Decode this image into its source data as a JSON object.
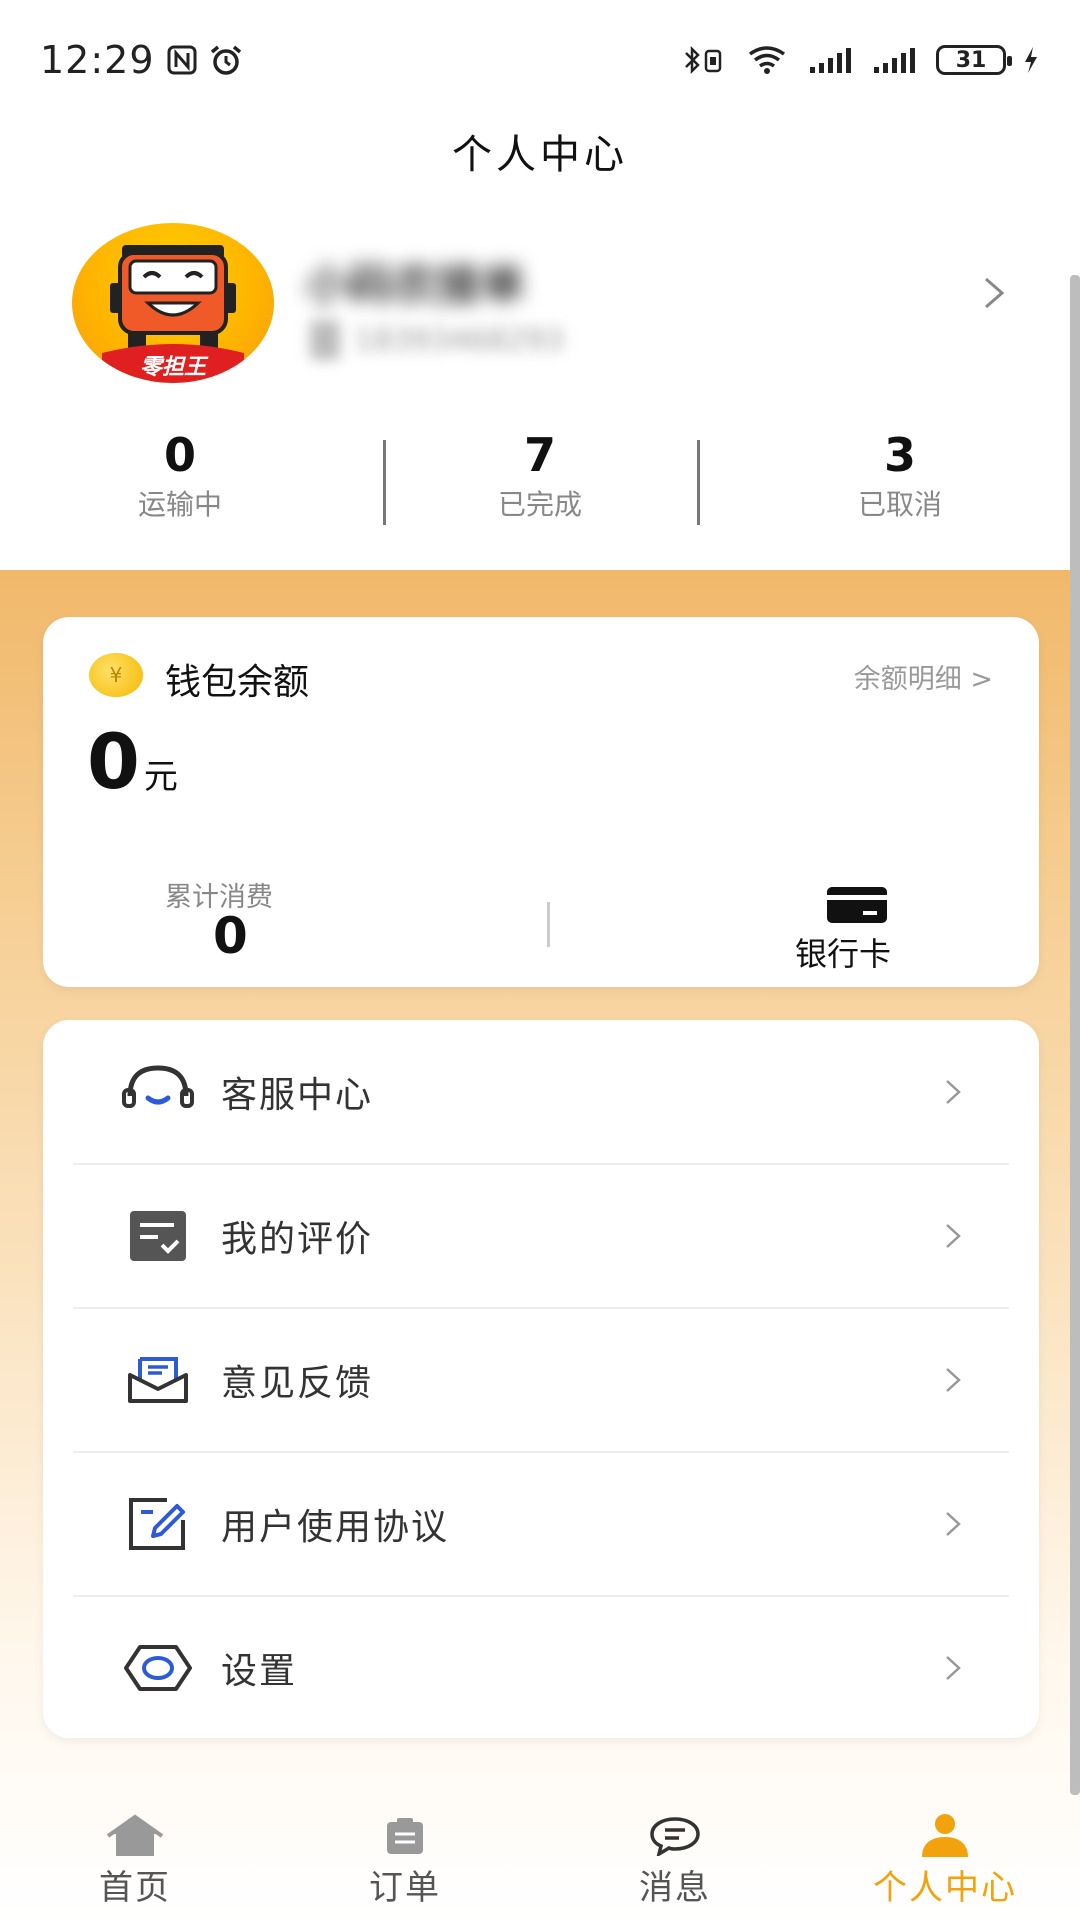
{
  "status_bar": {
    "time": "12:29",
    "battery": "31"
  },
  "header": {
    "title": "个人中心"
  },
  "profile": {
    "avatar_text": "零担王",
    "name": "小码农接单",
    "phone": "18393468293"
  },
  "stats": [
    {
      "value": "0",
      "label": "运输中"
    },
    {
      "value": "7",
      "label": "已完成"
    },
    {
      "value": "3",
      "label": "已取消"
    }
  ],
  "wallet": {
    "coin_symbol": "¥",
    "title": "钱包余额",
    "detail_link": "余额明细 >",
    "balance": "0",
    "unit": "元",
    "cumulative_label": "累计消费",
    "cumulative_value": "0",
    "bank_card_label": "银行卡"
  },
  "menu": [
    {
      "label": "客服中心",
      "icon": "headset-icon"
    },
    {
      "label": "我的评价",
      "icon": "review-icon"
    },
    {
      "label": "意见反馈",
      "icon": "feedback-mail-icon"
    },
    {
      "label": "用户使用协议",
      "icon": "agreement-edit-icon"
    },
    {
      "label": "设置",
      "icon": "settings-hexagon-icon"
    }
  ],
  "tabs": [
    {
      "label": "首页",
      "icon": "home-icon",
      "active": false
    },
    {
      "label": "订单",
      "icon": "clipboard-icon",
      "active": false
    },
    {
      "label": "消息",
      "icon": "chat-bubble-icon",
      "active": false
    },
    {
      "label": "个人中心",
      "icon": "person-icon",
      "active": true
    }
  ],
  "colors": {
    "accent": "#f2a20c",
    "gradient_top": "#f1b86a",
    "icon_blue": "#2d5bd7"
  }
}
